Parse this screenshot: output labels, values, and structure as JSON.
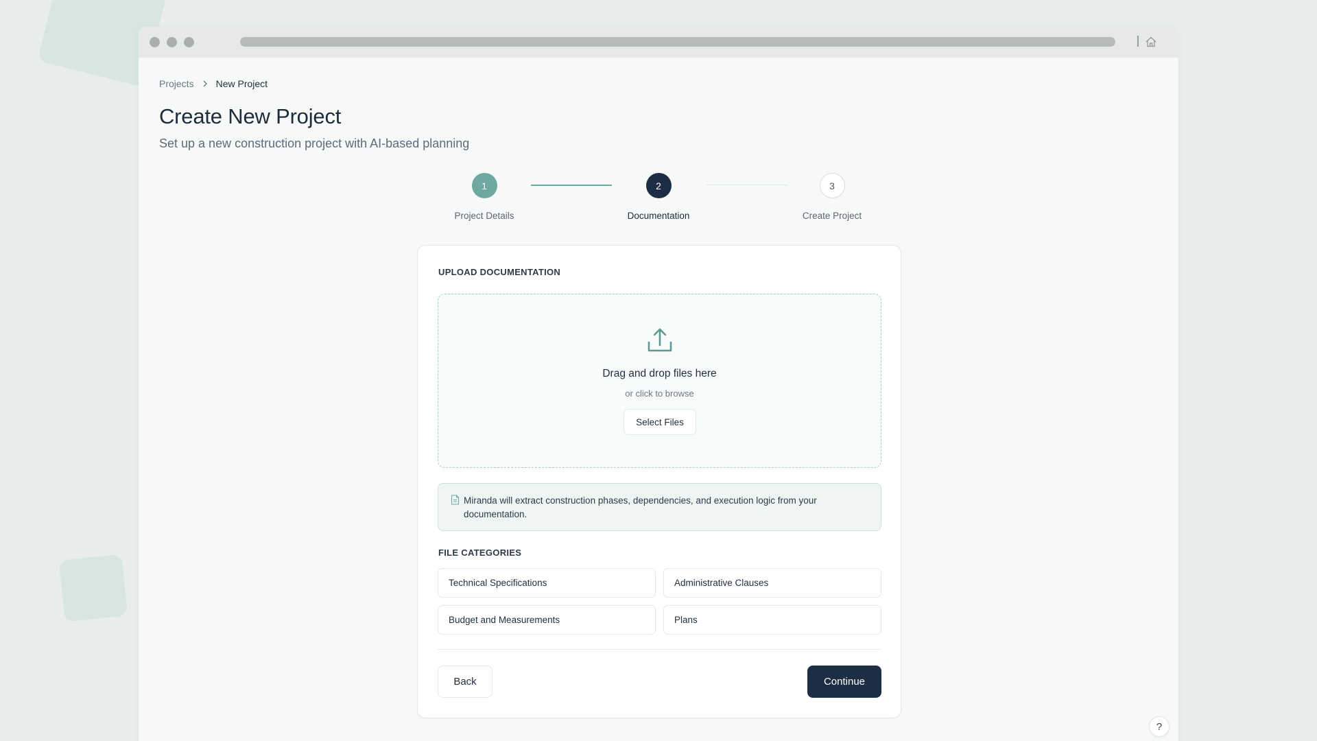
{
  "breadcrumb": {
    "parent": "Projects",
    "current": "New Project"
  },
  "header": {
    "title": "Create New Project",
    "subtitle": "Set up a new construction project with AI-based planning"
  },
  "steps": [
    {
      "number": "1",
      "label": "Project Details",
      "state": "completed"
    },
    {
      "number": "2",
      "label": "Documentation",
      "state": "active"
    },
    {
      "number": "3",
      "label": "Create Project",
      "state": "pending"
    }
  ],
  "upload": {
    "section_title": "UPLOAD DOCUMENTATION",
    "dropzone_title": "Drag and drop files here",
    "dropzone_subtitle": "or click to browse",
    "select_button": "Select Files",
    "icon": "upload-icon"
  },
  "info": {
    "icon": "document-icon",
    "text": "Miranda will extract construction phases, dependencies, and execution logic from your documentation."
  },
  "categories": {
    "title": "FILE CATEGORIES",
    "items": [
      "Technical Specifications",
      "Administrative Clauses",
      "Budget and Measurements",
      "Plans"
    ]
  },
  "actions": {
    "back": "Back",
    "continue": "Continue"
  },
  "help": {
    "label": "?"
  },
  "colors": {
    "primary": "#1d2e44",
    "accent": "#6fa8a0",
    "background": "#e9eeed",
    "card": "#ffffff"
  }
}
